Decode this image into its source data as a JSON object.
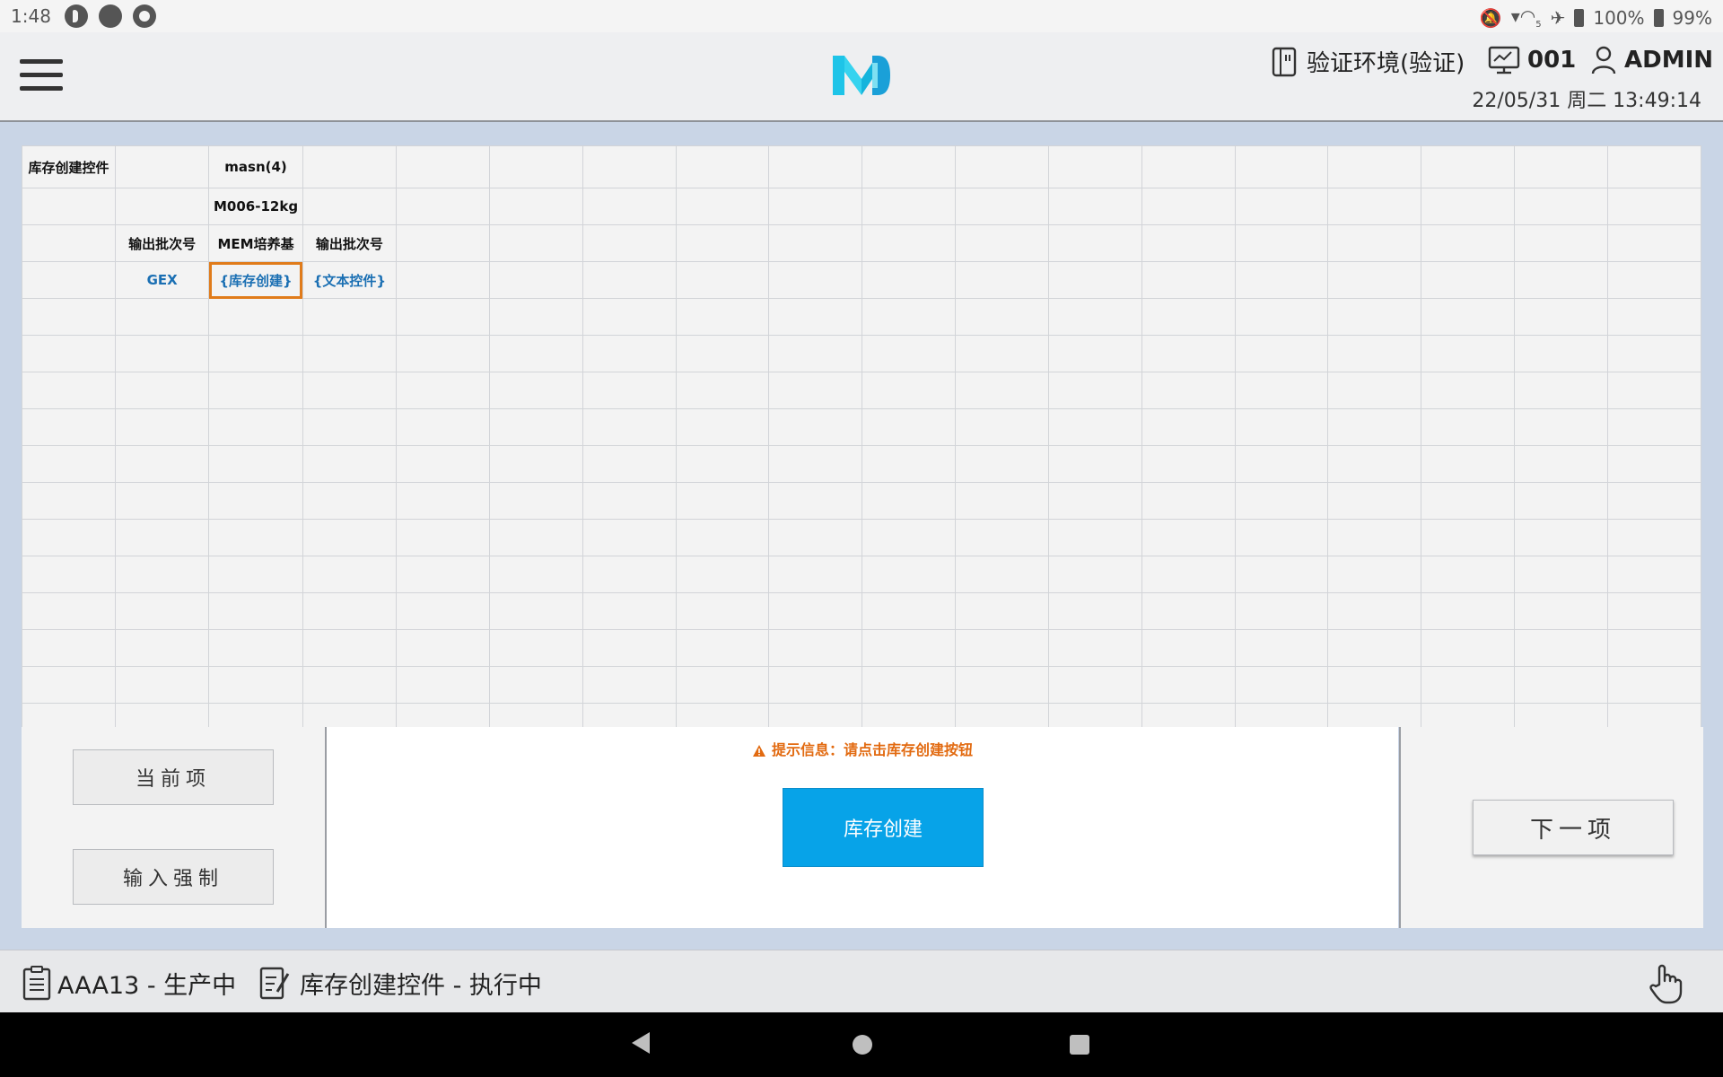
{
  "status_bar": {
    "time": "1:48",
    "wifi_label": "5",
    "battery_percent_1": "100%",
    "battery_percent_2": "99%"
  },
  "header": {
    "environment": "验证环境(验证)",
    "station": "001",
    "user": "ADMIN",
    "datetime": "22/05/31 周二 13:49:14"
  },
  "grid": {
    "r0": [
      "库存创建控件",
      "",
      "masn(4)",
      ""
    ],
    "r1": [
      "",
      "",
      "M006-12kg",
      ""
    ],
    "r2": [
      "",
      "输出批次号",
      "MEM培养基",
      "输出批次号"
    ],
    "r3": [
      "",
      "GEX",
      "{库存创建}",
      "{文本控件}"
    ]
  },
  "panel": {
    "current_item": "当前项",
    "input_force": "输入强制",
    "hint": "提示信息：请点击库存创建按钮",
    "create_button": "库存创建",
    "next_item": "下一项"
  },
  "footer": {
    "order": "AAA13 - 生产中",
    "task": "库存创建控件 - 执行中"
  },
  "colors": {
    "accent": "#07a3e8",
    "warning": "#e26a10",
    "link": "#1a6fb3",
    "selection": "#e07b1a"
  }
}
